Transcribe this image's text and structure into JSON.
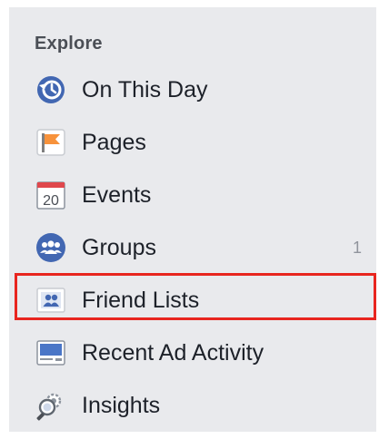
{
  "explore": {
    "heading": "Explore",
    "items": [
      {
        "label": "On This Day",
        "icon": "on-this-day-icon"
      },
      {
        "label": "Pages",
        "icon": "pages-flag-icon"
      },
      {
        "label": "Events",
        "icon": "events-calendar-icon"
      },
      {
        "label": "Groups",
        "icon": "groups-icon",
        "count": "1"
      },
      {
        "label": "Friend Lists",
        "icon": "friend-lists-icon"
      },
      {
        "label": "Recent Ad Activity",
        "icon": "recent-ad-activity-icon"
      },
      {
        "label": "Insights",
        "icon": "insights-icon"
      }
    ],
    "calendar_day": "20"
  },
  "colors": {
    "panel_background": "#e9eaed",
    "brand_blue": "#4267b2",
    "highlight_border": "#e8251f",
    "flag_orange": "#f7923b",
    "calendar_red": "#e0474c"
  }
}
